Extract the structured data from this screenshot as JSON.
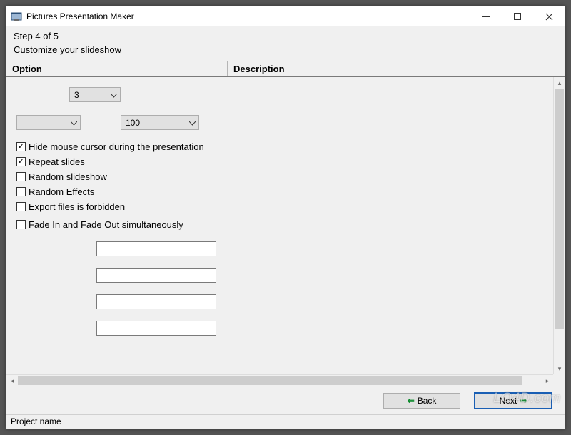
{
  "window": {
    "title": "Pictures Presentation Maker"
  },
  "wizard": {
    "step_label": "Step 4 of 5",
    "subtitle": "Customize your slideshow"
  },
  "columns": {
    "option": "Option",
    "description": "Description"
  },
  "controls": {
    "combo_top_value": "3",
    "combo_left_value": "",
    "combo_right_value": "100"
  },
  "checkboxes": [
    {
      "label": "Hide mouse cursor during the presentation",
      "checked": true
    },
    {
      "label": "Repeat slides",
      "checked": true
    },
    {
      "label": "Random slideshow",
      "checked": false
    },
    {
      "label": "Random Effects",
      "checked": false
    },
    {
      "label": "Export files is forbidden",
      "checked": false
    },
    {
      "label": "Fade In and Fade Out simultaneously",
      "checked": false
    }
  ],
  "textfields": [
    "",
    "",
    "",
    ""
  ],
  "nav": {
    "back": "Back",
    "next": "Next"
  },
  "status": "Project name",
  "watermark": "LO4D.com"
}
